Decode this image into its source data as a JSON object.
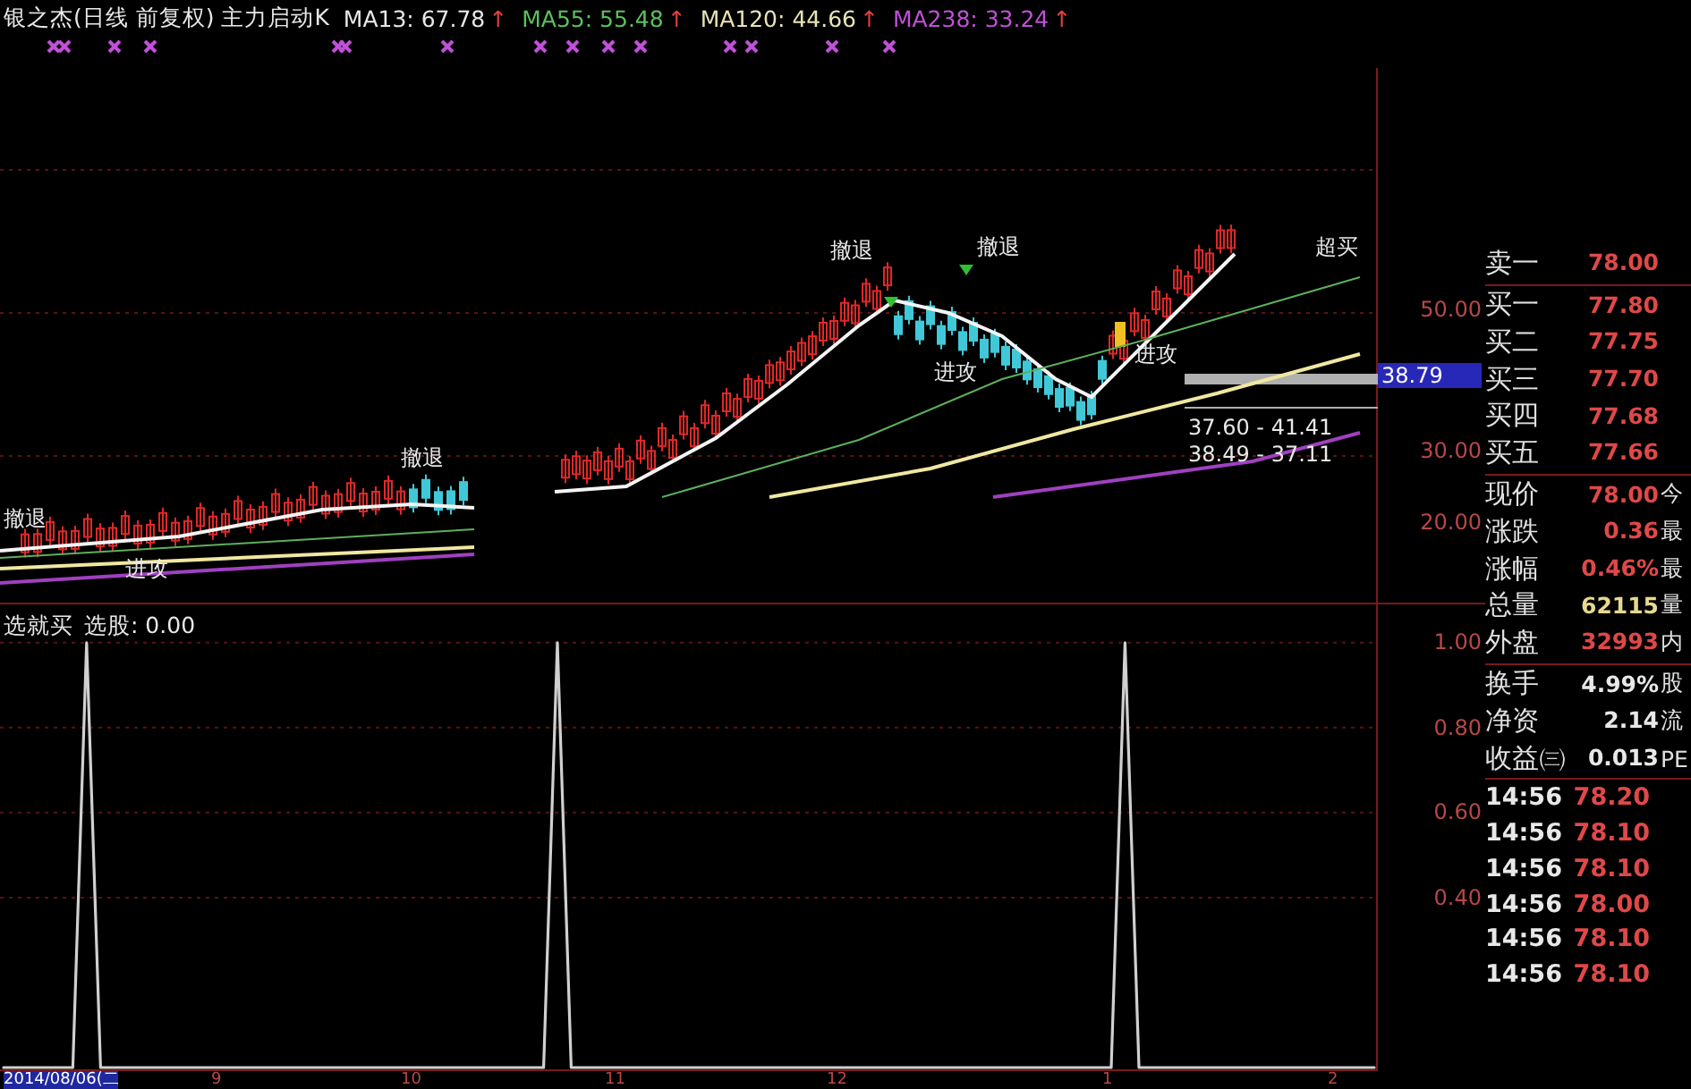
{
  "header": {
    "title": "银之杰(日线 前复权) 主力启动K",
    "indicators": [
      {
        "label": "MA13: 67.78",
        "arrow": "↑",
        "color": "#e8e8e8"
      },
      {
        "label": "MA55: 55.48",
        "arrow": "↑",
        "color": "#5cc05c"
      },
      {
        "label": "MA120: 44.66",
        "arrow": "↑",
        "color": "#e8e2b8"
      },
      {
        "label": "MA238: 33.24",
        "arrow": "↑",
        "color": "#c050d8"
      }
    ]
  },
  "main_chart": {
    "annotations": [
      {
        "text": "撤退"
      },
      {
        "text": "进攻"
      },
      {
        "text": "撤退"
      },
      {
        "text": "撤退"
      },
      {
        "text": "撤退"
      },
      {
        "text": "进攻"
      },
      {
        "text": "超买"
      },
      {
        "text": "进攻"
      },
      {
        "text": "37.60 - 41.41"
      },
      {
        "text": "38.49 - 37.11"
      }
    ],
    "price_axis": [
      {
        "label": "50.00",
        "selected": false
      },
      {
        "label": "38.79",
        "selected": true
      },
      {
        "label": "30.00",
        "selected": false
      },
      {
        "label": "20.00",
        "selected": false
      }
    ]
  },
  "lower_panel": {
    "title": "选就买",
    "reading": "选股: 0.00",
    "chart_data": {
      "type": "line",
      "grid": true,
      "ylim": [
        0,
        1.09
      ],
      "yticks": [
        {
          "value": 1,
          "label": "1.00"
        },
        {
          "value": 0.8,
          "label": "0.80"
        },
        {
          "value": 0.6,
          "label": "0.60"
        },
        {
          "value": 0.4,
          "label": "0.40"
        }
      ],
      "series": [
        {
          "color": "#d0d0d0",
          "values": [
            0,
            0,
            0,
            0,
            0,
            0,
            1,
            0,
            0,
            0,
            0,
            0,
            0,
            0,
            0,
            0,
            0,
            0,
            0,
            0,
            0,
            0,
            0,
            0,
            0,
            0,
            0,
            0,
            0,
            0,
            0,
            0,
            0,
            0,
            0,
            0,
            0,
            0,
            0,
            0,
            1,
            0,
            0,
            0,
            0,
            0,
            0,
            0,
            0,
            0,
            0,
            0,
            0,
            0,
            0,
            0,
            0,
            0,
            0,
            0,
            0,
            0,
            0,
            0,
            0,
            0,
            0,
            0,
            0,
            0,
            0,
            0,
            0,
            0,
            0,
            0,
            0,
            0,
            0,
            0,
            0,
            1,
            0,
            0,
            0,
            0,
            0,
            0,
            0,
            0,
            0,
            0,
            0,
            0,
            0,
            0,
            0,
            0,
            0,
            0
          ]
        }
      ]
    }
  },
  "x_axis": {
    "date": "2014/08/06(二",
    "ticks": [
      "9",
      "10",
      "11",
      "12",
      "1",
      "2"
    ]
  },
  "quote": {
    "order_book": [
      {
        "label": "卖一",
        "price": "78.00"
      },
      {
        "label": "买一",
        "price": "77.80"
      },
      {
        "label": "买二",
        "price": "77.75"
      },
      {
        "label": "买三",
        "price": "77.70"
      },
      {
        "label": "买四",
        "price": "77.68"
      },
      {
        "label": "买五",
        "price": "77.66"
      }
    ],
    "stats": [
      {
        "label": "现价",
        "value": "78.00",
        "extra": "今",
        "color": "#e04848"
      },
      {
        "label": "涨跌",
        "value": "0.36",
        "extra": "最",
        "color": "#e04848"
      },
      {
        "label": "涨幅",
        "value": "0.46%",
        "extra": "最",
        "color": "#e04848"
      },
      {
        "label": "总量",
        "value": "62115",
        "extra": "量",
        "color": "#e8d890"
      },
      {
        "label": "外盘",
        "value": "32993",
        "extra": "内",
        "color": "#e04848"
      },
      {
        "label": "换手",
        "value": "4.99%",
        "extra": "股",
        "color": "#e8e8e8"
      },
      {
        "label": "净资",
        "value": "2.14",
        "extra": "流",
        "color": "#e8e8e8"
      },
      {
        "label": "收益㈢",
        "value": "0.013",
        "extra": "PE",
        "color": "#e8e8e8"
      }
    ],
    "ticks": [
      {
        "time": "14:56",
        "price": "78.20"
      },
      {
        "time": "14:56",
        "price": "78.10"
      },
      {
        "time": "14:56",
        "price": "78.10"
      },
      {
        "time": "14:56",
        "price": "78.00"
      },
      {
        "time": "14:56",
        "price": "78.10"
      },
      {
        "time": "14:56",
        "price": "78.10"
      }
    ]
  }
}
